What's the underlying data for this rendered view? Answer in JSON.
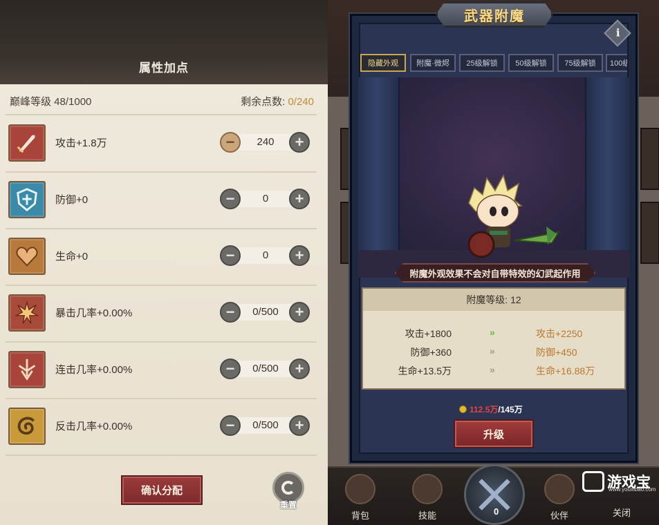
{
  "left": {
    "title": "属性加点",
    "peak_level": "巅峰等级 48/1000",
    "remain_label": "剩余点数:",
    "remain_value": "0/240",
    "attributes": [
      {
        "label": "攻击+1.8万",
        "value": "240",
        "icon": "sword-icon",
        "color": "#a8443a"
      },
      {
        "label": "防御+0",
        "value": "0",
        "icon": "shield-icon",
        "color": "#3a8aa8"
      },
      {
        "label": "生命+0",
        "value": "0",
        "icon": "heart-icon",
        "color": "#b87a3a"
      },
      {
        "label": "暴击几率+0.00%",
        "value": "0/500",
        "icon": "burst-icon",
        "color": "#a84a3a"
      },
      {
        "label": "连击几率+0.00%",
        "value": "0/500",
        "icon": "triple-strike-icon",
        "color": "#a8443a"
      },
      {
        "label": "反击几率+0.00%",
        "value": "0/500",
        "icon": "counter-swirl-icon",
        "color": "#c89a3a"
      }
    ],
    "confirm_label": "确认分配",
    "reset_label": "重置"
  },
  "dialog": {
    "title": "武器附魔",
    "tabs": [
      "隐藏外观",
      "附魔·微烬",
      "25级解锁",
      "50级解锁",
      "75级解锁",
      "100级"
    ],
    "active_tab": 0,
    "note": "附魔外观效果不会对自带特效的幻武起作用",
    "enchant_level": "附魔等级: 12",
    "stats": [
      {
        "current": "攻击+1800",
        "next": "攻击+2250"
      },
      {
        "current": "防御+360",
        "next": "防御+450"
      },
      {
        "current": "生命+13.5万",
        "next": "生命+16.88万"
      }
    ],
    "cost_have": "112.5万",
    "cost_need": "/145万",
    "upgrade_label": "升级"
  },
  "bottom_nav": {
    "items": [
      "背包",
      "技能",
      "伙伴",
      "关闭"
    ],
    "center_count": "0"
  },
  "watermark": {
    "text": "游戏宝",
    "sub": "www.youxibao.com"
  }
}
